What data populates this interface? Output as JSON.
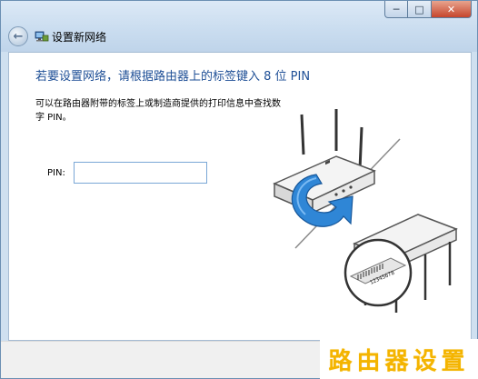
{
  "window": {
    "title": "设置新网络",
    "caption": {
      "minimize": "─",
      "maximize": "□",
      "close": "✕"
    },
    "back_icon": "back-arrow-icon"
  },
  "main": {
    "heading": "若要设置网络，请根据路由器上的标签键入 8 位 PIN",
    "description": "可以在路由器附带的标签上或制造商提供的打印信息中查找数字 PIN。",
    "pin_label": "PIN:",
    "pin_value": ""
  },
  "illustration": {
    "label_text": "12345678"
  },
  "watermark": {
    "text": "路由器设置"
  },
  "colors": {
    "heading": "#1e4f96",
    "arrow": "#2f86d6",
    "watermark": "#f4b400"
  }
}
